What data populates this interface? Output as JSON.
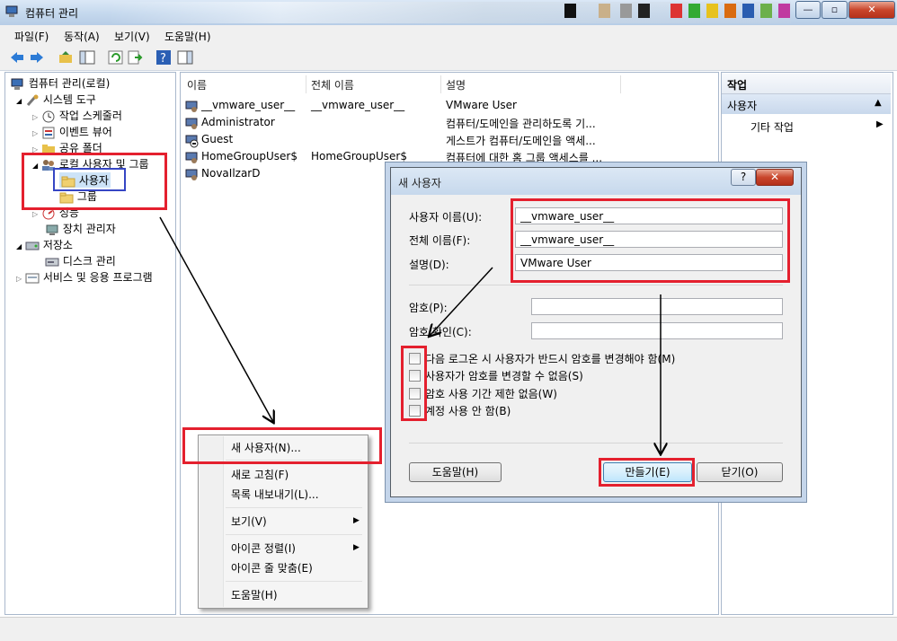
{
  "window": {
    "title": "컴퓨터 관리"
  },
  "menubar": [
    "파일(F)",
    "동작(A)",
    "보기(V)",
    "도움말(H)"
  ],
  "tree": {
    "root": "컴퓨터 관리(로컬)",
    "system_tools": "시스템 도구",
    "task_scheduler": "작업 스케줄러",
    "event_viewer": "이벤트 뷰어",
    "shared_folders": "공유 폴더",
    "local_users_groups": "로컬 사용자 및 그룹",
    "users": "사용자",
    "groups": "그룹",
    "performance": "성능",
    "device_manager": "장치 관리자",
    "storage": "저장소",
    "disk_management": "디스크 관리",
    "services_apps": "서비스 및 응용 프로그램"
  },
  "list": {
    "columns": [
      "이름",
      "전체 이름",
      "설명"
    ],
    "rows": [
      {
        "name": "__vmware_user__",
        "full_name": "__vmware_user__",
        "description": "VMware User"
      },
      {
        "name": "Administrator",
        "full_name": "",
        "description": "컴퓨터/도메인을 관리하도록 기..."
      },
      {
        "name": "Guest",
        "full_name": "",
        "description": "게스트가 컴퓨터/도메인을 액세..."
      },
      {
        "name": "HomeGroupUser$",
        "full_name": "HomeGroupUser$",
        "description": "컴퓨터에 대한 홈 그룹 액세스를 ..."
      },
      {
        "name": "NovaIlzarD",
        "full_name": "",
        "description": ""
      }
    ]
  },
  "actions": {
    "header": "작업",
    "selected": "사용자",
    "more": "기타 작업"
  },
  "context_menu": {
    "new_user": "새 사용자(N)...",
    "refresh": "새로 고침(F)",
    "export": "목록 내보내기(L)...",
    "view": "보기(V)",
    "arrange_icons": "아이콘 정렬(I)",
    "line_up_icons": "아이콘 줄 맞춤(E)",
    "help": "도움말(H)"
  },
  "dialog": {
    "title": "새 사용자",
    "help_q": "?",
    "close_x": "✕",
    "username_label": "사용자 이름(U):",
    "username_value": "__vmware_user__",
    "fullname_label": "전체 이름(F):",
    "fullname_value": "__vmware_user__",
    "desc_label": "설명(D):",
    "desc_value": "VMware User",
    "password_label": "암호(P):",
    "confirm_label": "암호 확인(C):",
    "chk_must_change": "다음 로그온 시 사용자가 반드시 암호를 변경해야 함(M)",
    "chk_cannot_change": "사용자가 암호를 변경할 수 없음(S)",
    "chk_never_expires": "암호 사용 기간 제한 없음(W)",
    "chk_disabled": "계정 사용 안 함(B)",
    "btn_help": "도움말(H)",
    "btn_create": "만들기(E)",
    "btn_close": "닫기(O)"
  },
  "annotation_color": "#e4202e"
}
